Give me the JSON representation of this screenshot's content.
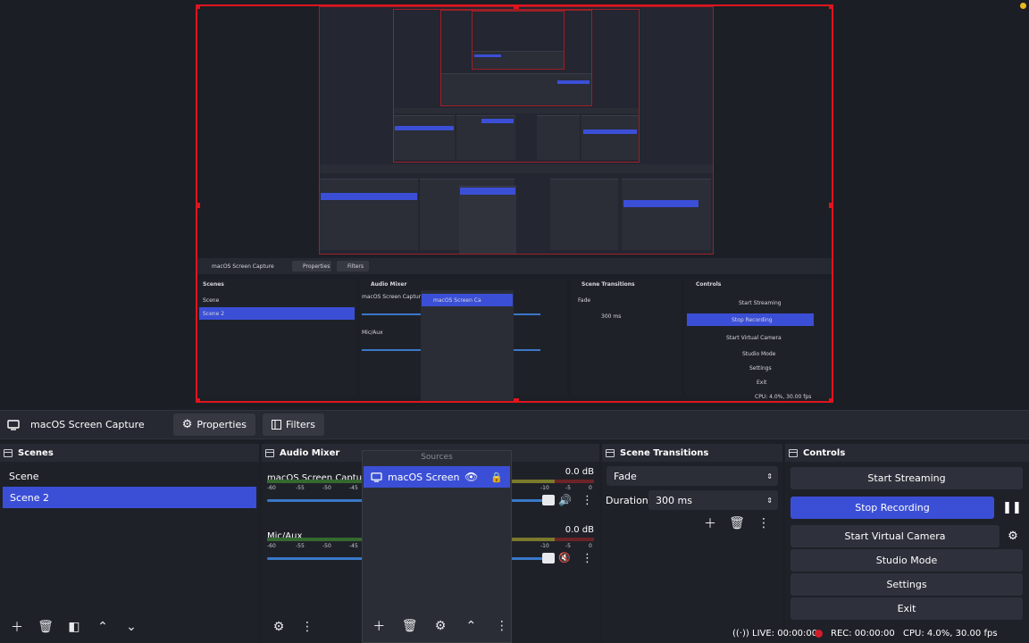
{
  "toolbar": {
    "source_name": "macOS Screen Capture",
    "properties_label": "Properties",
    "filters_label": "Filters"
  },
  "scenes": {
    "title": "Scenes",
    "items": [
      {
        "label": "Scene",
        "selected": false
      },
      {
        "label": "Scene 2",
        "selected": true
      }
    ]
  },
  "audio_mixer": {
    "title": "Audio Mixer",
    "channels": [
      {
        "name": "macOS Screen Capture",
        "db": "0.0 dB",
        "muted": false
      },
      {
        "name": "Mic/Aux",
        "db": "0.0 dB",
        "muted": true
      }
    ],
    "ticks": [
      "-60",
      "-55",
      "-50",
      "-45",
      "-10",
      "-5",
      "0"
    ]
  },
  "sources": {
    "title": "Sources",
    "items": [
      {
        "label": "macOS Screen Ca",
        "visible": true,
        "locked": true
      }
    ]
  },
  "transitions": {
    "title": "Scene Transitions",
    "selected": "Fade",
    "duration_label": "Duration",
    "duration_value": "300 ms"
  },
  "controls": {
    "title": "Controls",
    "start_streaming": "Start Streaming",
    "stop_recording": "Stop Recording",
    "start_virtual_camera": "Start Virtual Camera",
    "studio_mode": "Studio Mode",
    "settings": "Settings",
    "exit": "Exit"
  },
  "status": {
    "live": "LIVE: 00:00:00",
    "rec": "REC: 00:00:00",
    "cpu": "CPU: 4.0%, 30.00 fps"
  },
  "colors": {
    "accent": "#3b4fd6",
    "frame_red": "#e0141e",
    "rec_dot": "#d11e2a"
  }
}
